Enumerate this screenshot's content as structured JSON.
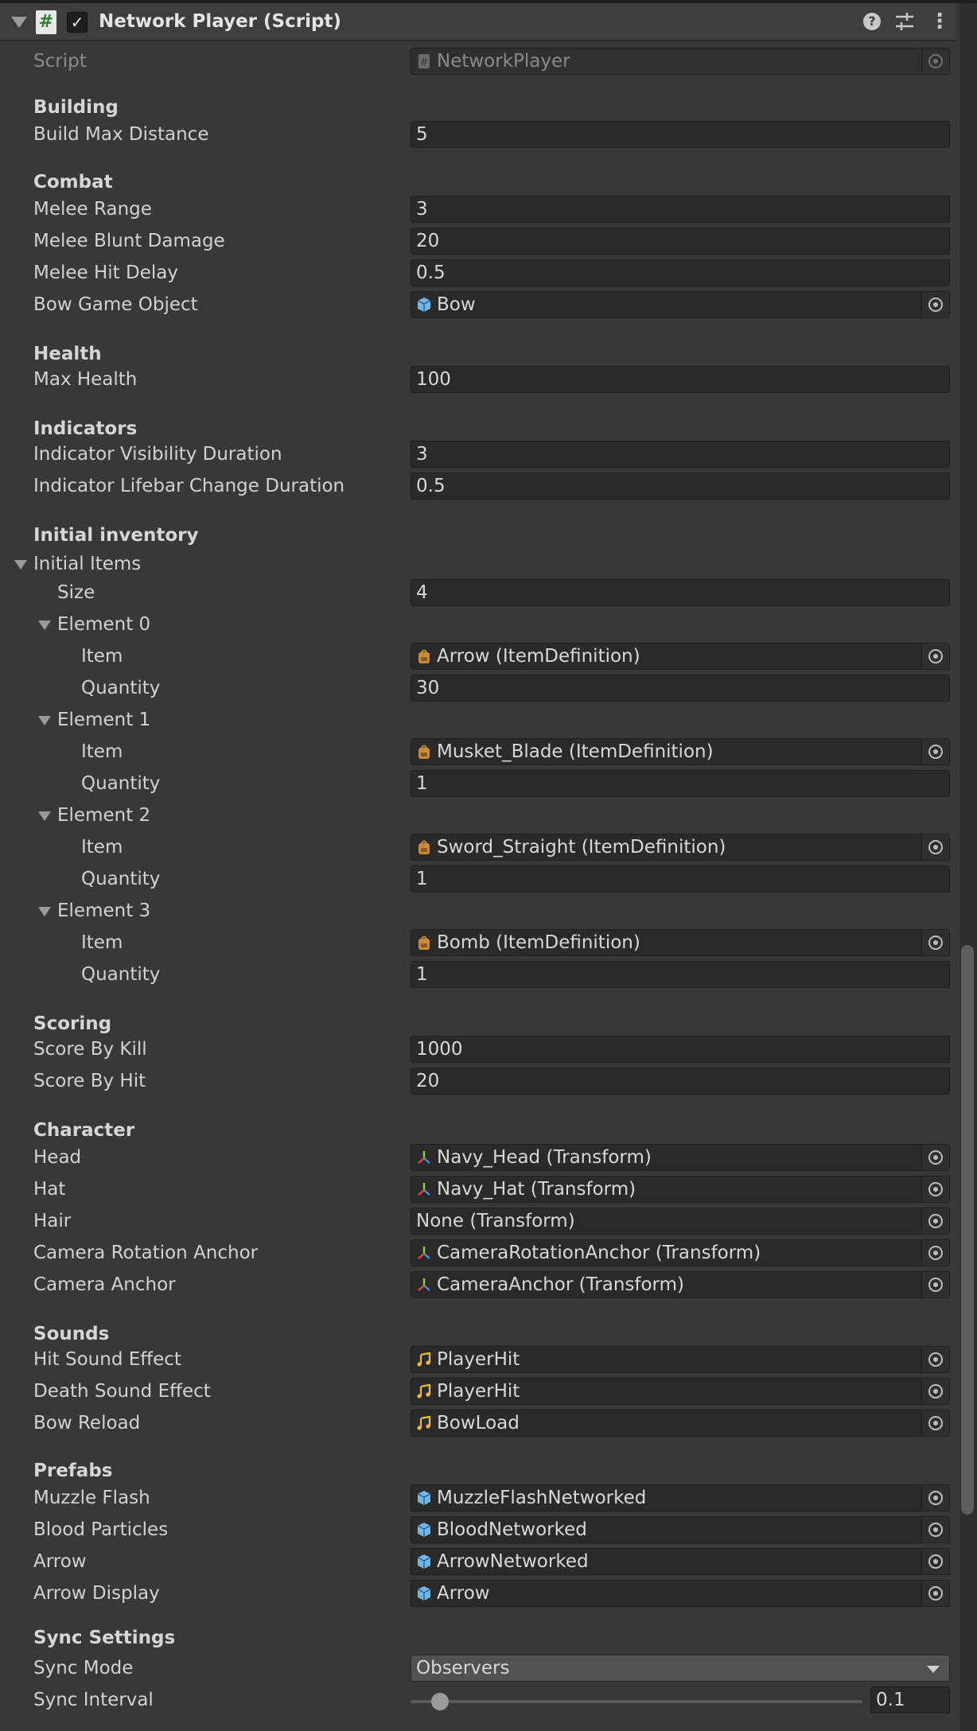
{
  "header": {
    "title": "Network Player (Script)",
    "script_icon_glyph": "#",
    "enabled_check": "✓",
    "help_glyph": "?",
    "more_glyph": "⋮"
  },
  "script_row": {
    "label": "Script",
    "value": "NetworkPlayer",
    "icon": "script-file-icon"
  },
  "sections": {
    "building": "Building",
    "combat": "Combat",
    "health": "Health",
    "indicators": "Indicators",
    "initial_inventory": "Initial inventory",
    "scoring": "Scoring",
    "character": "Character",
    "sounds": "Sounds",
    "prefabs": "Prefabs",
    "sync_settings": "Sync Settings"
  },
  "building": {
    "build_max_distance": {
      "label": "Build Max Distance",
      "value": "5"
    }
  },
  "combat": {
    "melee_range": {
      "label": "Melee Range",
      "value": "3"
    },
    "melee_blunt_damage": {
      "label": "Melee Blunt Damage",
      "value": "20"
    },
    "melee_hit_delay": {
      "label": "Melee Hit Delay",
      "value": "0.5"
    },
    "bow_game_object": {
      "label": "Bow Game Object",
      "value": "Bow",
      "icon": "prefab-cube-icon"
    }
  },
  "health": {
    "max_health": {
      "label": "Max Health",
      "value": "100"
    }
  },
  "indicators": {
    "visibility_duration": {
      "label": "Indicator Visibility Duration",
      "value": "3"
    },
    "lifebar_change_duration": {
      "label": "Indicator Lifebar Change Duration",
      "value": "0.5"
    }
  },
  "inventory": {
    "initial_items_label": "Initial Items",
    "size_label": "Size",
    "size_value": "4",
    "item_label": "Item",
    "quantity_label": "Quantity",
    "elements": [
      {
        "label": "Element 0",
        "item": "Arrow (ItemDefinition)",
        "quantity": "30"
      },
      {
        "label": "Element 1",
        "item": "Musket_Blade (ItemDefinition)",
        "quantity": "1"
      },
      {
        "label": "Element 2",
        "item": "Sword_Straight (ItemDefinition)",
        "quantity": "1"
      },
      {
        "label": "Element 3",
        "item": "Bomb (ItemDefinition)",
        "quantity": "1"
      }
    ]
  },
  "scoring": {
    "score_by_kill": {
      "label": "Score By Kill",
      "value": "1000"
    },
    "score_by_hit": {
      "label": "Score By Hit",
      "value": "20"
    }
  },
  "character": {
    "head": {
      "label": "Head",
      "value": "Navy_Head (Transform)"
    },
    "hat": {
      "label": "Hat",
      "value": "Navy_Hat (Transform)"
    },
    "hair": {
      "label": "Hair",
      "value": "None (Transform)"
    },
    "camera_rotation_anchor": {
      "label": "Camera Rotation Anchor",
      "value": "CameraRotationAnchor (Transform)"
    },
    "camera_anchor": {
      "label": "Camera Anchor",
      "value": "CameraAnchor (Transform)"
    }
  },
  "sounds": {
    "hit_sound_effect": {
      "label": "Hit Sound Effect",
      "value": "PlayerHit"
    },
    "death_sound_effect": {
      "label": "Death Sound Effect",
      "value": "PlayerHit"
    },
    "bow_reload": {
      "label": "Bow Reload",
      "value": "BowLoad"
    }
  },
  "prefabs": {
    "muzzle_flash": {
      "label": "Muzzle Flash",
      "value": "MuzzleFlashNetworked"
    },
    "blood_particles": {
      "label": "Blood Particles",
      "value": "BloodNetworked"
    },
    "arrow": {
      "label": "Arrow",
      "value": "ArrowNetworked"
    },
    "arrow_display": {
      "label": "Arrow Display",
      "value": "Arrow"
    }
  },
  "sync": {
    "sync_mode": {
      "label": "Sync Mode",
      "value": "Observers"
    },
    "sync_interval": {
      "label": "Sync Interval",
      "value": "0.1",
      "slider_fraction": 0.045
    }
  },
  "colors": {
    "panel_bg": "#383838",
    "field_bg": "#2a2a2a",
    "prefab_icon": "#6fb7e8",
    "item_icon": "#c98a3a",
    "sound_icon": "#e8b84a",
    "script_hash": "#2e7d32"
  }
}
